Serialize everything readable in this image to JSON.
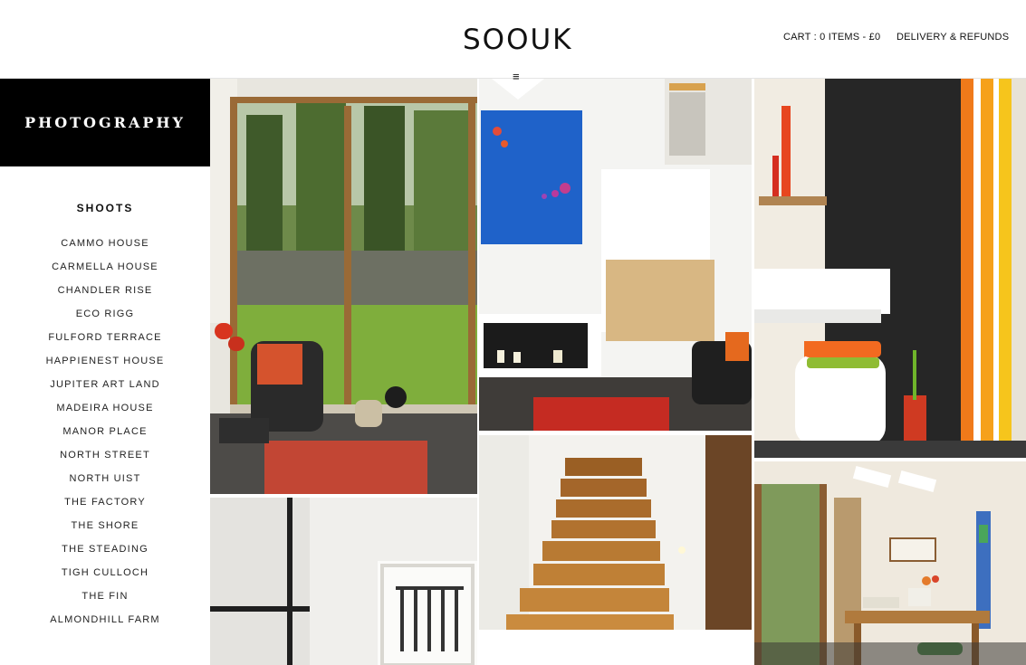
{
  "header": {
    "logo": "SOOUK",
    "cart_label": "CART : 0 ITEMS - £0",
    "delivery_label": "DELIVERY & REFUNDS",
    "menu_icon": "≡"
  },
  "sidebar": {
    "title": "PHOTOGRAPHY",
    "shoots_heading": "SHOOTS",
    "items": [
      "CAMMO HOUSE",
      "CARMELLA HOUSE",
      "CHANDLER RISE",
      "ECO RIGG",
      "FULFORD TERRACE",
      "HAPPIENEST HOUSE",
      "JUPITER ART LAND",
      "MADEIRA HOUSE",
      "MANOR PLACE",
      "NORTH STREET",
      "NORTH UIST",
      "THE FACTORY",
      "THE SHORE",
      "THE STEADING",
      "TIGH CULLOCH",
      "THE FIN",
      "ALMONDHILL FARM"
    ]
  },
  "gallery": {
    "photos": [
      {
        "name": "living-room-window-photo"
      },
      {
        "name": "fireplace-blue-art-photo"
      },
      {
        "name": "bathroom-orange-stripes-photo"
      },
      {
        "name": "staircase-railing-photo"
      },
      {
        "name": "wooden-stairs-photo"
      },
      {
        "name": "dining-room-photo"
      }
    ]
  },
  "colors": {
    "sidebar_title_bg": "#000000",
    "accent_red": "#c8342a",
    "stripe_orange": "#f07a1a",
    "stripe_yellow": "#f6c51c"
  }
}
